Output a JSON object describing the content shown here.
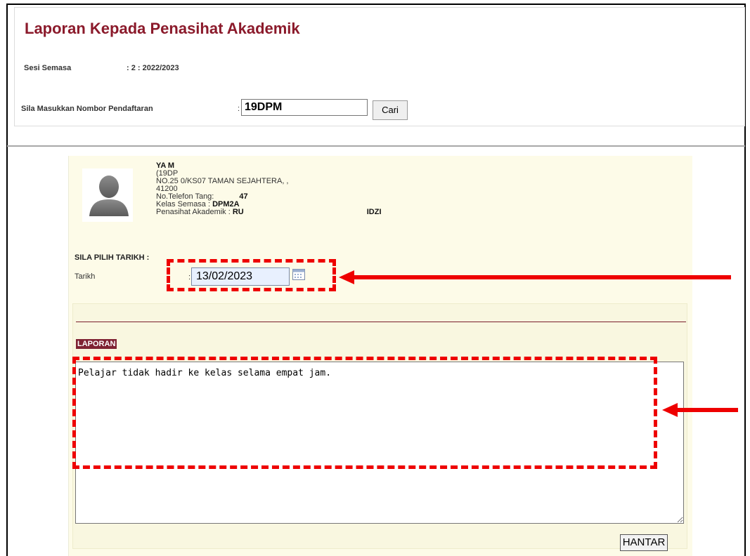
{
  "header": {
    "title": "Laporan Kepada Penasihat Akademik",
    "sesi_label": "Sesi Semasa",
    "sesi_value": ": 2 : 2022/2023"
  },
  "search": {
    "label": "Sila Masukkan Nombor Pendaftaran",
    "colon": ":",
    "value": "19DPM",
    "button_label": "Cari"
  },
  "student": {
    "name": "YA                                      M",
    "reg": "(19DP",
    "address_1": "NO.25                                                                    0/KS07 TAMAN SEJAHTERA, ,",
    "address_2": "41200",
    "phone_label": "No.Telefon Tang:",
    "phone_value": "47",
    "kelas_label": "Kelas Semasa : ",
    "kelas_value": "DPM2A",
    "penasihat_label": "Penasihat Akademik : ",
    "penasihat_value": "RU",
    "penasihat_tail": "IDZI"
  },
  "date_picker": {
    "heading": "SILA PILIH TARIKH :",
    "label": "Tarikh",
    "colon": ":",
    "value": "13/02/2023"
  },
  "report": {
    "heading": "LAPORAN",
    "text": "Pelajar tidak hadir ke kelas selama empat jam.",
    "submit_label": "HANTAR"
  },
  "colors": {
    "title": "#8b1a2b",
    "annotation": "#ee0000",
    "panel_bg": "#fdfbe8",
    "badge_bg": "#7f2233"
  },
  "icons": [
    "avatar-placeholder",
    "calendar-icon",
    "resize-grip-icon",
    "arrow-left-icon"
  ]
}
